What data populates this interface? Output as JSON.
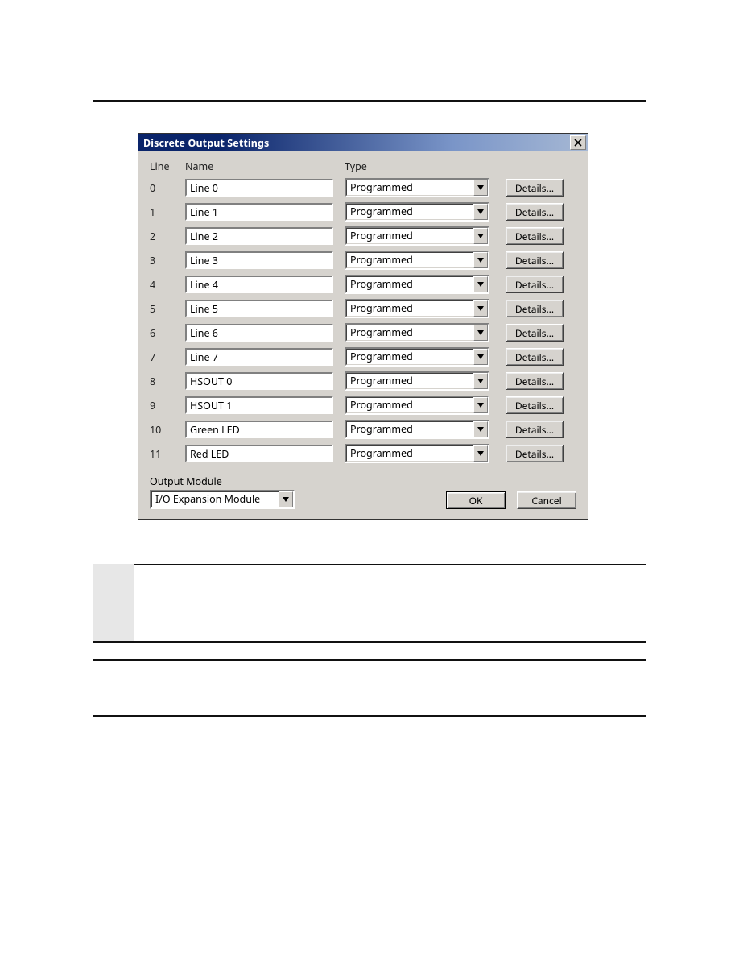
{
  "dialog": {
    "title": "Discrete Output Settings",
    "close_glyph": "X",
    "headers": {
      "line": "Line",
      "name": "Name",
      "type": "Type"
    },
    "rows": [
      {
        "line": "0",
        "name": "Line 0",
        "type": "Programmed",
        "details": "Details..."
      },
      {
        "line": "1",
        "name": "Line 1",
        "type": "Programmed",
        "details": "Details..."
      },
      {
        "line": "2",
        "name": "Line 2",
        "type": "Programmed",
        "details": "Details..."
      },
      {
        "line": "3",
        "name": "Line 3",
        "type": "Programmed",
        "details": "Details..."
      },
      {
        "line": "4",
        "name": "Line 4",
        "type": "Programmed",
        "details": "Details..."
      },
      {
        "line": "5",
        "name": "Line 5",
        "type": "Programmed",
        "details": "Details..."
      },
      {
        "line": "6",
        "name": "Line 6",
        "type": "Programmed",
        "details": "Details..."
      },
      {
        "line": "7",
        "name": "Line 7",
        "type": "Programmed",
        "details": "Details..."
      },
      {
        "line": "8",
        "name": "HSOUT 0",
        "type": "Programmed",
        "details": "Details..."
      },
      {
        "line": "9",
        "name": "HSOUT 1",
        "type": "Programmed",
        "details": "Details..."
      },
      {
        "line": "10",
        "name": "Green LED",
        "type": "Programmed",
        "details": "Details..."
      },
      {
        "line": "11",
        "name": "Red LED",
        "type": "Programmed",
        "details": "Details..."
      }
    ],
    "output_module_label": "Output Module",
    "output_module_value": "I/O Expansion Module",
    "ok": "OK",
    "cancel": "Cancel"
  }
}
